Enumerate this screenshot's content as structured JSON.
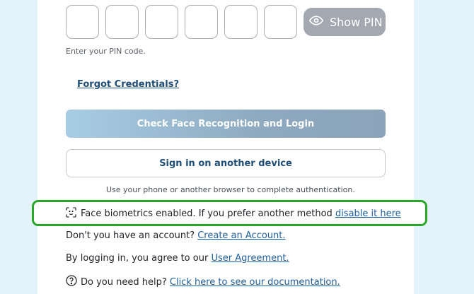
{
  "pin": {
    "boxes": [
      "",
      "",
      "",
      "",
      "",
      ""
    ],
    "show_pin_label": "Show PIN",
    "show_pin_icon": "eye-icon",
    "hint": "Enter your PIN code."
  },
  "forgot_link": "Forgot Credentials?",
  "primary_button": "Check Face Recognition and Login",
  "secondary_button": "Sign in on another device",
  "secondary_hint": "Use your phone or another browser to complete authentication.",
  "biometrics": {
    "icon": "face-scan-icon",
    "text": "Face biometrics enabled. If you prefer another method ",
    "link": "disable it here",
    "highlight_color": "#2aa62a"
  },
  "signup": {
    "text": "Don't you have an account? ",
    "link": "Create an Account."
  },
  "agreement": {
    "text": "By logging in, you agree to our ",
    "link": "User Agreement."
  },
  "help": {
    "icon": "question-circle-icon",
    "text": "Do you need help? ",
    "link": "Click here to see our documentation."
  }
}
